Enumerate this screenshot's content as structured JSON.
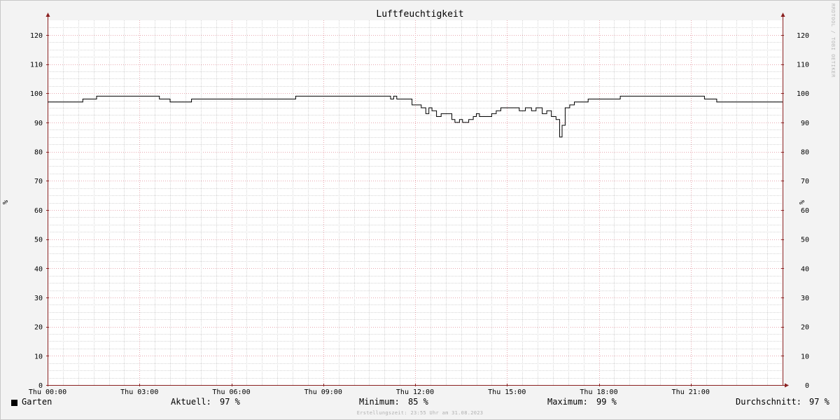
{
  "chart_data": {
    "type": "line",
    "title": "Luftfeuchtigkeit",
    "ylabel": "%",
    "ylim": [
      0,
      125
    ],
    "yticks": [
      0,
      10,
      20,
      30,
      40,
      50,
      60,
      70,
      80,
      90,
      100,
      110,
      120
    ],
    "xlim": [
      0,
      24
    ],
    "xtick_labels": [
      "Thu 00:00",
      "Thu 03:00",
      "Thu 06:00",
      "Thu 09:00",
      "Thu 12:00",
      "Thu 15:00",
      "Thu 18:00",
      "Thu 21:00"
    ],
    "xtick_hours": [
      0,
      3,
      6,
      9,
      12,
      15,
      18,
      21
    ],
    "grid": true,
    "series": [
      {
        "name": "Garten",
        "color": "#000000",
        "x": [
          0,
          1.15,
          1.6,
          3.65,
          4.0,
          4.7,
          8.1,
          11.1,
          11.2,
          11.3,
          11.4,
          11.9,
          12.2,
          12.35,
          12.45,
          12.55,
          12.7,
          12.85,
          13.2,
          13.3,
          13.45,
          13.55,
          13.75,
          13.9,
          14.0,
          14.1,
          14.25,
          14.5,
          14.65,
          14.8,
          14.95,
          15.4,
          15.6,
          15.8,
          15.95,
          16.15,
          16.3,
          16.45,
          16.6,
          16.65,
          16.72,
          16.8,
          16.9,
          17.05,
          17.2,
          17.65,
          18.7,
          21.45,
          21.85,
          24.0
        ],
        "y": [
          97,
          98,
          99,
          98,
          97,
          98,
          99,
          99,
          98,
          99,
          98,
          96,
          95,
          93,
          95,
          94,
          92,
          93,
          91,
          90,
          91,
          90,
          91,
          92,
          93,
          92,
          92,
          93,
          94,
          95,
          95,
          94,
          95,
          94,
          95,
          93,
          94,
          92,
          91,
          91,
          85,
          89,
          95,
          96,
          97,
          98,
          99,
          98,
          97,
          97
        ]
      }
    ]
  },
  "legend": {
    "name": "Garten",
    "current_label": "Aktuell:",
    "current_value": "97 %",
    "min_label": "Minimum:",
    "min_value": "85 %",
    "max_label": "Maximum:",
    "max_value": "99 %",
    "avg_label": "Durchschnitt:",
    "avg_value": "97 %"
  },
  "footer": "Erstellungszeit: 23:55 Uhr am 31.08.2023",
  "watermark": "RRDTOOL / TOBI OETIKER",
  "colors": {
    "background": "#f3f3f3",
    "plot_background": "#ffffff",
    "major_grid": "#e8a8b0",
    "minor_grid": "#d6d6d6",
    "axis": "#8a2020",
    "line": "#000000"
  }
}
